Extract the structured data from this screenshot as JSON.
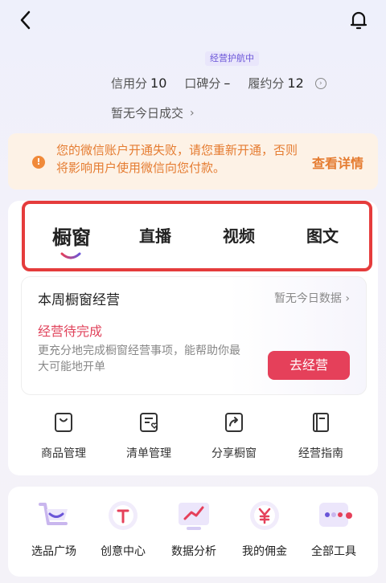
{
  "header": {
    "badge": "经营护航中"
  },
  "scores": [
    {
      "label": "信用分",
      "value": "10"
    },
    {
      "label": "口碑分",
      "value": "–"
    },
    {
      "label": "履约分",
      "value": "12"
    }
  ],
  "no_deal": "暂无今日成交",
  "alert": {
    "message": "您的微信账户开通失败，请您重新开通，否则将影响用户使用微信向您付款。",
    "action": "查看详情"
  },
  "tabs": [
    "橱窗",
    "直播",
    "视频",
    "图文"
  ],
  "week": {
    "title": "本周橱窗经营",
    "nodata": "暂无今日数据",
    "pending": "经营待完成",
    "desc": "更充分地完成橱窗经营事项，能帮助你最大可能地开单",
    "button": "去经营"
  },
  "tools": [
    "商品管理",
    "清单管理",
    "分享橱窗",
    "经营指南"
  ],
  "quick_tools": [
    "选品广场",
    "创意中心",
    "数据分析",
    "我的佣金",
    "全部工具"
  ],
  "colors": {
    "accent": "#e5405a",
    "warning": "#e57c31",
    "highlight_border": "#e53c3c"
  }
}
